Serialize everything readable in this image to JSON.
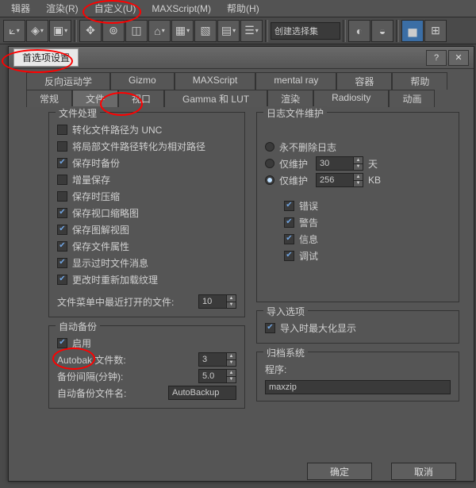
{
  "menubar": {
    "items": [
      "辑器",
      "渲染(R)",
      "自定义(U)",
      "MAXScript(M)",
      "帮助(H)"
    ]
  },
  "toolbar": {
    "combo": "创建选择集"
  },
  "dialog": {
    "title": "首选项设置",
    "help_icon": "?",
    "close_icon": "✕",
    "tabs_row1": [
      "反向运动学",
      "Gizmo",
      "MAXScript",
      "mental ray",
      "容器",
      "帮助"
    ],
    "tabs_row2": [
      "常规",
      "文件",
      "视口",
      "Gamma 和 LUT",
      "渲染",
      "Radiosity",
      "动画"
    ],
    "active_tab": "文件",
    "file_handling": {
      "title": "文件处理",
      "items": [
        {
          "label": "转化文件路径为 UNC",
          "checked": false
        },
        {
          "label": "将局部文件路径转化为相对路径",
          "checked": false
        },
        {
          "label": "保存时备份",
          "checked": true
        },
        {
          "label": "增量保存",
          "checked": false
        },
        {
          "label": "保存时压缩",
          "checked": false
        },
        {
          "label": "保存视口缩略图",
          "checked": true
        },
        {
          "label": "保存图解视图",
          "checked": true
        },
        {
          "label": "保存文件属性",
          "checked": true
        },
        {
          "label": "显示过时文件消息",
          "checked": true
        },
        {
          "label": "更改时重新加载纹理",
          "checked": true
        }
      ],
      "recent_label": "文件菜单中最近打开的文件:",
      "recent_value": "10"
    },
    "autobackup": {
      "title": "自动备份",
      "enable_label": "启用",
      "enable_checked": true,
      "count_label": "Autobak 文件数:",
      "count_value": "3",
      "interval_label": "备份间隔(分钟):",
      "interval_value": "5.0",
      "name_label": "自动备份文件名:",
      "name_value": "AutoBackup"
    },
    "logfile": {
      "title": "日志文件维护",
      "never_label": "永不删除日志",
      "keep_days_label": "仅维护",
      "keep_days_value": "30",
      "keep_days_unit": "天",
      "keep_kb_label": "仅维护",
      "keep_kb_value": "256",
      "keep_kb_unit": "KB",
      "keep_kb_checked": true,
      "levels": [
        {
          "label": "错误",
          "checked": true
        },
        {
          "label": "警告",
          "checked": true
        },
        {
          "label": "信息",
          "checked": true
        },
        {
          "label": "调试",
          "checked": true
        }
      ]
    },
    "import": {
      "title": "导入选项",
      "zoom_label": "导入时最大化显示",
      "zoom_checked": true
    },
    "archive": {
      "title": "归档系统",
      "program_label": "程序:",
      "program_value": "maxzip"
    },
    "ok": "确定",
    "cancel": "取消"
  }
}
